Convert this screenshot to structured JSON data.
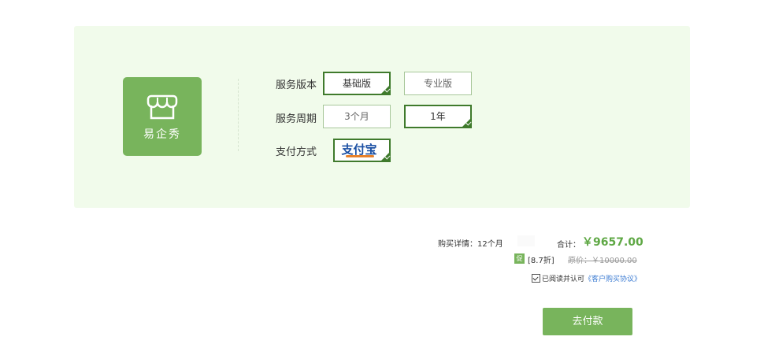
{
  "logo": {
    "text": "易企秀",
    "icon": "storefront-icon"
  },
  "rows": {
    "version": {
      "label": "服务版本",
      "options": [
        {
          "label": "基础版",
          "selected": true
        },
        {
          "label": "专业版",
          "selected": false
        }
      ]
    },
    "period": {
      "label": "服务周期",
      "options": [
        {
          "label": "3个月",
          "selected": false
        },
        {
          "label": "1年",
          "selected": true
        }
      ]
    },
    "payment": {
      "label": "支付方式",
      "method": "支付宝",
      "icon": "alipay-logo-icon",
      "selected": true
    }
  },
  "summary": {
    "detail_label": "购买详情：12个月",
    "total_label": "合计：",
    "total_price": "￥9657.00",
    "promo_badge": "促",
    "discount": "[8.7折]",
    "original_price": "原价：￥10000.00"
  },
  "agreement": {
    "checked": true,
    "text": "已阅读并认可",
    "link": "《客户购买协议》"
  },
  "pay_button": "去付款",
  "colors": {
    "accent": "#78b45c",
    "selected_border": "#3f7a2c",
    "panel_bg": "#f1fbeb",
    "price": "#5fa845"
  }
}
